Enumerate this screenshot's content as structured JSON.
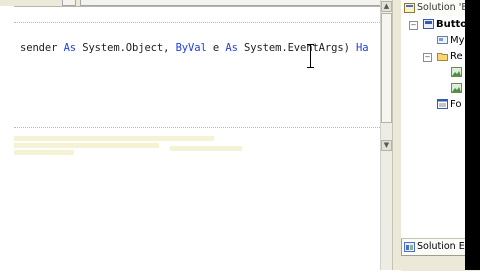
{
  "editor": {
    "code_line": [
      {
        "text": "sender ",
        "kind": "plain"
      },
      {
        "text": "As",
        "kind": "kw"
      },
      {
        "text": " System.Object, ",
        "kind": "plain"
      },
      {
        "text": "ByVal",
        "kind": "kw"
      },
      {
        "text": " e ",
        "kind": "plain"
      },
      {
        "text": "As",
        "kind": "kw"
      },
      {
        "text": " System.EventArgs) ",
        "kind": "plain"
      },
      {
        "text": "Ha",
        "kind": "kw"
      }
    ],
    "scroll_up": "▲",
    "scroll_down": "▼"
  },
  "solution_explorer": {
    "title": "Solution 'Bu",
    "items": [
      {
        "label": "Buttor",
        "bold": true,
        "icon": "project-icon",
        "expander": "−"
      },
      {
        "label": "My",
        "bold": false,
        "icon": "my-project-icon",
        "expander": ""
      },
      {
        "label": "Re",
        "bold": false,
        "icon": "folder-icon",
        "expander": "−"
      },
      {
        "label": "",
        "bold": false,
        "icon": "image-icon",
        "expander": ""
      },
      {
        "label": "",
        "bold": false,
        "icon": "image-icon",
        "expander": ""
      },
      {
        "label": "Fo",
        "bold": false,
        "icon": "form-icon",
        "expander": ""
      }
    ],
    "tab_label": "Solution Expl"
  },
  "colors": {
    "keyword": "#1c3ee0",
    "code_text": "#222222"
  }
}
